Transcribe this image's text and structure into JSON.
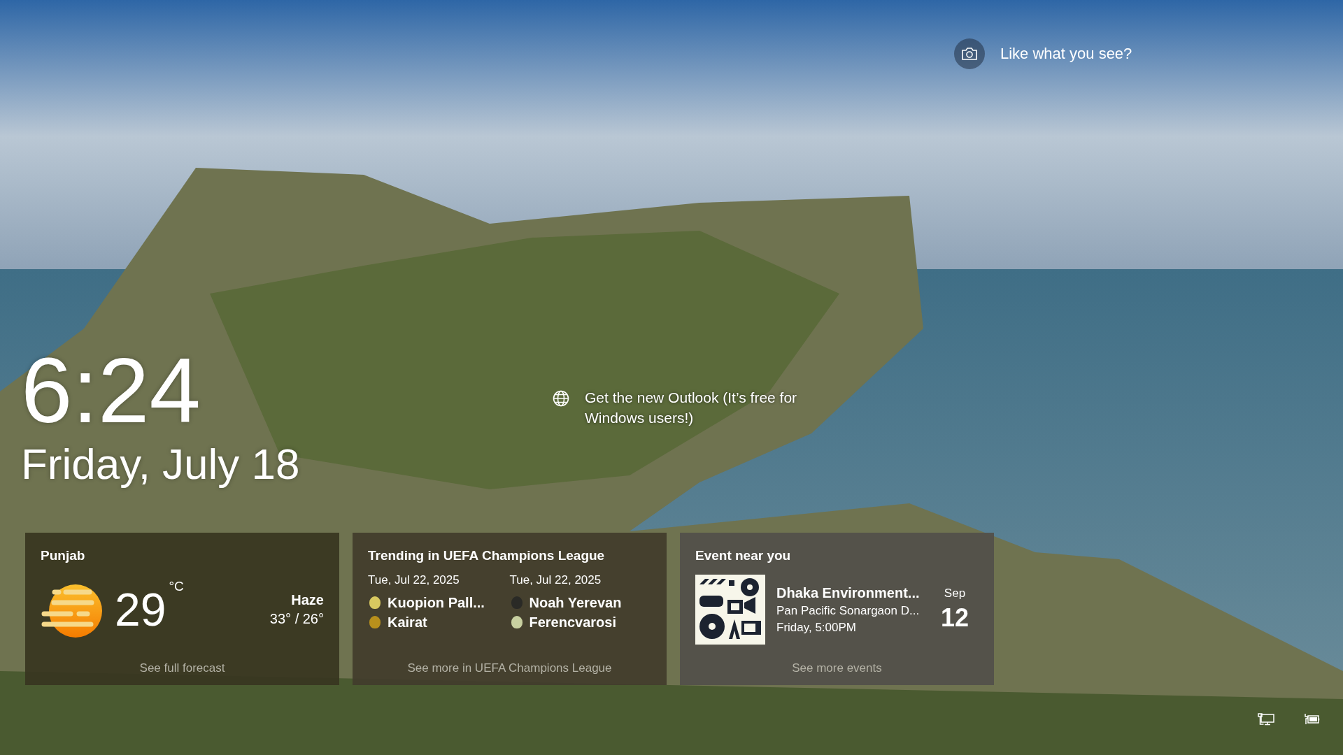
{
  "spotlight": {
    "prompt": "Like what you see?"
  },
  "clock": {
    "time": "6:24",
    "date": "Friday, July 18"
  },
  "tip": {
    "text": "Get the new Outlook (It’s free for Windows users!)"
  },
  "weather": {
    "location": "Punjab",
    "temperature": "29",
    "unit": "°C",
    "condition": "Haze",
    "range": "33° / 26°",
    "link": "See full forecast"
  },
  "sports": {
    "title": "Trending in UEFA Champions League",
    "link": "See more in UEFA Champions League",
    "matches": [
      {
        "date": "Tue, Jul 22, 2025",
        "teams": [
          {
            "name": "Kuopion Pall...",
            "color": "#d8c860"
          },
          {
            "name": "Kairat",
            "color": "#b8901c"
          }
        ]
      },
      {
        "date": "Tue, Jul 22, 2025",
        "teams": [
          {
            "name": "Noah Yerevan",
            "color": "#2a2a26"
          },
          {
            "name": "Ferencvarosi",
            "color": "#c8d0a0"
          }
        ]
      }
    ]
  },
  "event": {
    "title": "Event near you",
    "name": "Dhaka Environment...",
    "venue": "Pan Pacific Sonargaon D...",
    "time": "Friday, 5:00PM",
    "month": "Sep",
    "day": "12",
    "link": "See more events"
  }
}
